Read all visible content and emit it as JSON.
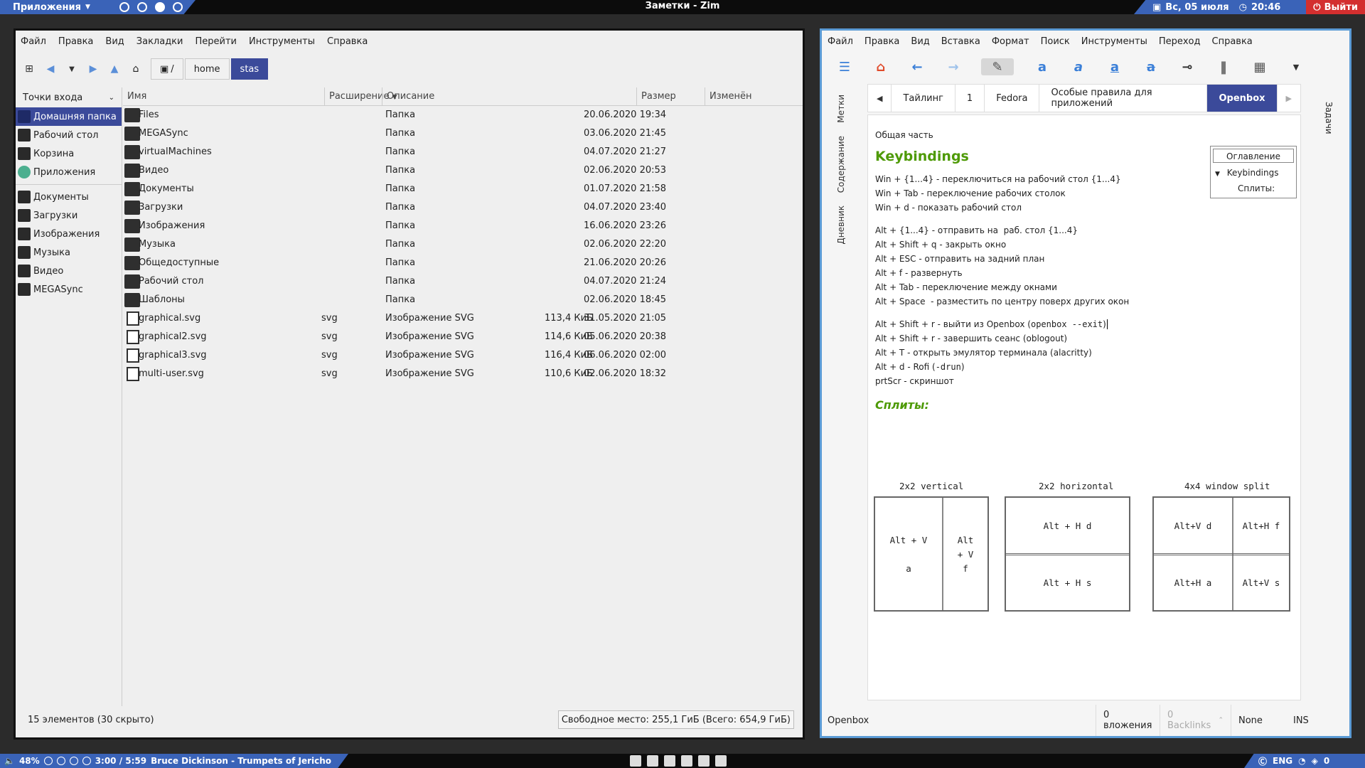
{
  "topbar": {
    "apps_label": "Приложения",
    "window_title": "Заметки - Zim",
    "date": "Вс, 05 июля",
    "time": "20:46",
    "logout": "Выйти"
  },
  "bottombar": {
    "volume": "48%",
    "track_time": "3:00 / 5:59",
    "track_title": "Bruce Dickinson - Trumpets of Jericho",
    "lang": "ENG",
    "notifications": "0"
  },
  "filemanager": {
    "menu": [
      "Файл",
      "Правка",
      "Вид",
      "Закладки",
      "Перейти",
      "Инструменты",
      "Справка"
    ],
    "path": {
      "root": "/",
      "crumbs": [
        "home",
        "stas"
      ]
    },
    "places_label": "Точки входа",
    "places": [
      "Домашняя папка",
      "Рабочий стол",
      "Корзина",
      "Приложения"
    ],
    "bookmarks": [
      "Документы",
      "Загрузки",
      "Изображения",
      "Музыка",
      "Видео",
      "MEGASync"
    ],
    "columns": {
      "name": "Имя",
      "ext": "Расширение",
      "desc": "Описание",
      "size": "Размер",
      "modified": "Изменён"
    },
    "rows": [
      {
        "name": "Files",
        "ext": "",
        "desc": "Папка",
        "size": "",
        "modified": "20.06.2020 19:34",
        "type": "folder"
      },
      {
        "name": "MEGASync",
        "ext": "",
        "desc": "Папка",
        "size": "",
        "modified": "03.06.2020 21:45",
        "type": "folder"
      },
      {
        "name": "virtualMachines",
        "ext": "",
        "desc": "Папка",
        "size": "",
        "modified": "04.07.2020 21:27",
        "type": "folder"
      },
      {
        "name": "Видео",
        "ext": "",
        "desc": "Папка",
        "size": "",
        "modified": "02.06.2020 20:53",
        "type": "folder"
      },
      {
        "name": "Документы",
        "ext": "",
        "desc": "Папка",
        "size": "",
        "modified": "01.07.2020 21:58",
        "type": "folder"
      },
      {
        "name": "Загрузки",
        "ext": "",
        "desc": "Папка",
        "size": "",
        "modified": "04.07.2020 23:40",
        "type": "folder"
      },
      {
        "name": "Изображения",
        "ext": "",
        "desc": "Папка",
        "size": "",
        "modified": "16.06.2020 23:26",
        "type": "folder"
      },
      {
        "name": "Музыка",
        "ext": "",
        "desc": "Папка",
        "size": "",
        "modified": "02.06.2020 22:20",
        "type": "folder"
      },
      {
        "name": "Общедоступные",
        "ext": "",
        "desc": "Папка",
        "size": "",
        "modified": "21.06.2020 20:26",
        "type": "folder"
      },
      {
        "name": "Рабочий стол",
        "ext": "",
        "desc": "Папка",
        "size": "",
        "modified": "04.07.2020 21:24",
        "type": "folder"
      },
      {
        "name": "Шаблоны",
        "ext": "",
        "desc": "Папка",
        "size": "",
        "modified": "02.06.2020 18:45",
        "type": "folder"
      },
      {
        "name": "graphical.svg",
        "ext": "svg",
        "desc": "Изображение SVG",
        "size": "113,4 КиБ",
        "modified": "31.05.2020 21:05",
        "type": "file"
      },
      {
        "name": "graphical2.svg",
        "ext": "svg",
        "desc": "Изображение SVG",
        "size": "114,6 КиБ",
        "modified": "05.06.2020 20:38",
        "type": "file"
      },
      {
        "name": "graphical3.svg",
        "ext": "svg",
        "desc": "Изображение SVG",
        "size": "116,4 КиБ",
        "modified": "06.06.2020 02:00",
        "type": "file"
      },
      {
        "name": "multi-user.svg",
        "ext": "svg",
        "desc": "Изображение SVG",
        "size": "110,6 КиБ",
        "modified": "02.06.2020 18:32",
        "type": "file"
      }
    ],
    "status_count": "15 элементов (30 скрыто)",
    "status_free": "Свободное место: 255,1 ГиБ (Всего: 654,9 ГиБ)"
  },
  "zim": {
    "menu": [
      "Файл",
      "Правка",
      "Вид",
      "Вставка",
      "Формат",
      "Поиск",
      "Инструменты",
      "Переход",
      "Справка"
    ],
    "side_tabs": [
      "Метки",
      "Содержание",
      "Дневник"
    ],
    "right_tab": "Задачи",
    "tabs": [
      "Тайлинг",
      "1",
      "Fedora",
      "Особые правила для приложений",
      "Openbox"
    ],
    "active_tab": "Openbox",
    "toc": {
      "title": "Оглавление",
      "items": [
        "Keybindings",
        "Сплиты:"
      ]
    },
    "page": {
      "intro": "Общая часть",
      "h1": "Keybindings",
      "block1": [
        "Win + {1...4} - переключиться на рабочий стол {1...4}",
        "Win + Tab - переключение рабочих столок",
        "Win + d - показать рабочий стол"
      ],
      "block2": [
        "Alt + {1...4} - отправить на  раб. стол {1...4}",
        "Alt + Shift + q - закрыть окно",
        "Alt + ESC - отправить на задний план",
        "Alt + f - развернуть",
        "Alt + Tab - переключение между окнами",
        "Alt + Space  - разместить по центру поверх других окон"
      ],
      "exit_line": {
        "prefix": "Alt + Shift + r - выйти из Openbox (",
        "code": "openbox --exit",
        "suffix": ")"
      },
      "block3": [
        "Alt + Shift + r - завершить сеанс (oblogout)",
        "Alt + T - открыть эмулятор терминала (alacritty)"
      ],
      "rofi_line": {
        "prefix": "Alt + d - Rofi (",
        "code": "-drun",
        "suffix": ")"
      },
      "prtscr": "prtScr - скриншот",
      "h2": "Сплиты:",
      "splits": {
        "titles": [
          "2x2 vertical",
          "2x2 horizontal",
          "4x4 window split"
        ],
        "vertical": {
          "left": "Alt + V",
          "left2": "a",
          "right1": "Alt",
          "right2": "+ V",
          "right3": "f"
        },
        "horizontal": {
          "top": "Alt + H   d",
          "bottom": "Alt + H   s"
        },
        "grid": {
          "tl": "Alt+V d",
          "tr": "Alt+H f",
          "bl": "Alt+H a",
          "br": "Alt+V s"
        }
      }
    },
    "status": {
      "page": "Openbox",
      "attachments": "0 вложения",
      "backlinks": "0 Backlinks",
      "style": "None",
      "mode": "INS"
    }
  }
}
